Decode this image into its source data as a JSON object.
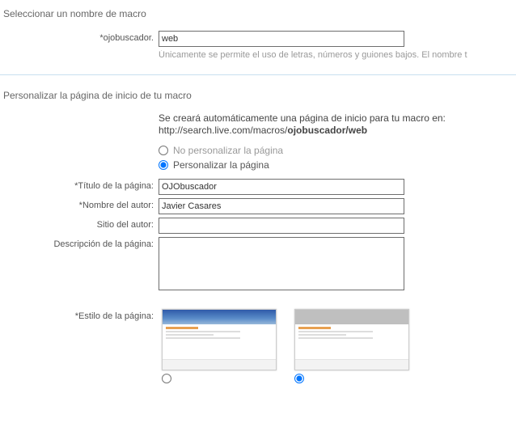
{
  "section1": {
    "title": "Seleccionar un nombre de macro",
    "field_label": "*ojobuscador.",
    "field_value": "web",
    "hint": "Únicamente se permite el uso de letras, números y guiones bajos. El nombre t"
  },
  "section2": {
    "title": "Personalizar la página de inicio de tu macro",
    "info_line1": "Se creará automáticamente una página de inicio para tu macro en:",
    "info_prefix": "http://search.live.com/macros/",
    "info_bold": "ojobuscador/web",
    "radio_no": "No personalizar la página",
    "radio_yes": "Personalizar la página",
    "fields": {
      "titulo_label": "*Título de la página:",
      "titulo_value": "OJObuscador",
      "autor_label": "*Nombre del autor:",
      "autor_value": "Javier Casares",
      "sitio_label": "Sitio del autor:",
      "sitio_value": "",
      "desc_label": "Descripción de la página:",
      "desc_value": "",
      "estilo_label": "*Estilo de la página:"
    }
  }
}
